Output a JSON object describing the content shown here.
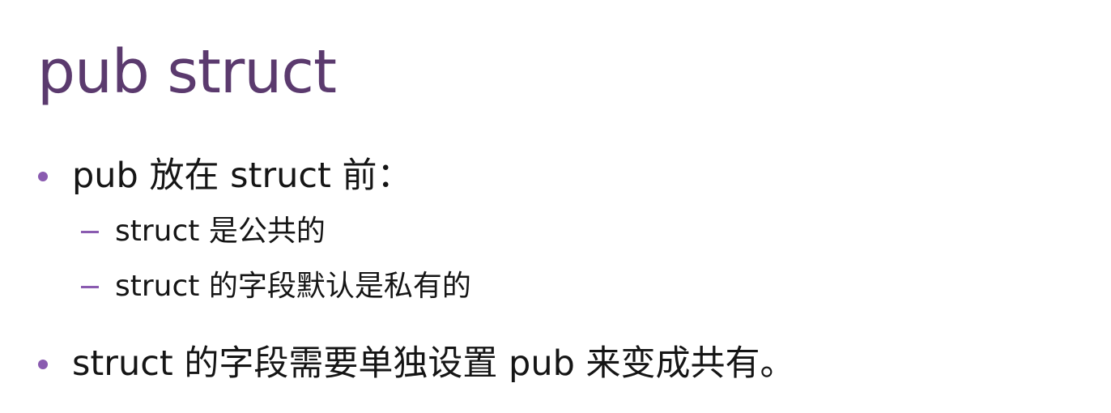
{
  "slide": {
    "title": "pub struct",
    "bullets": [
      {
        "text": "pub 放在 struct 前：",
        "sub": [
          "struct 是公共的",
          "struct 的字段默认是私有的"
        ]
      },
      {
        "text": "struct 的字段需要单独设置 pub 来变成共有。"
      }
    ]
  },
  "colors": {
    "title": "#5b3a6e",
    "bullet_marker": "#8a5bb0",
    "body_text": "#151515",
    "background": "#ffffff"
  }
}
